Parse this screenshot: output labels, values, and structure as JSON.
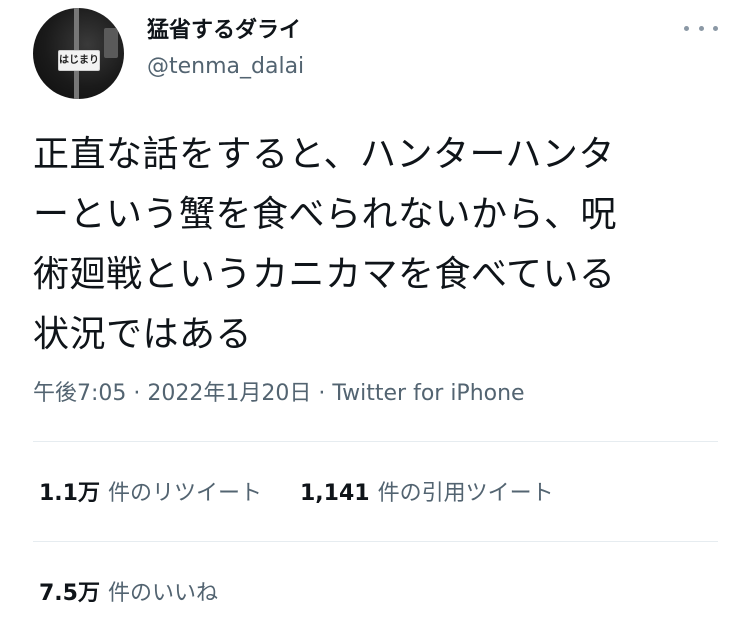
{
  "user": {
    "display_name": "猛省するダライ",
    "handle": "@tenma_dalai",
    "avatar_sign_text": "はじまり"
  },
  "tweet": {
    "text_lines": [
      "正直な話をすると、ハンターハンタ",
      "ーという蟹を食べられないから、呪",
      "術廻戦というカニカマを食べている",
      "状況ではある"
    ],
    "meta": "午後7:05 · 2022年1月20日 · Twitter for iPhone"
  },
  "stats": {
    "retweets": {
      "count": "1.1万",
      "label": "件のリツイート"
    },
    "quotes": {
      "count": "1,141",
      "label": "件の引用ツイート"
    },
    "likes": {
      "count": "7.5万",
      "label": "件のいいね"
    }
  },
  "icons": {
    "more": "more-horizontal-icon"
  },
  "colors": {
    "text_primary": "#0f1419",
    "text_secondary": "#536471",
    "divider": "#e6ecf0"
  }
}
